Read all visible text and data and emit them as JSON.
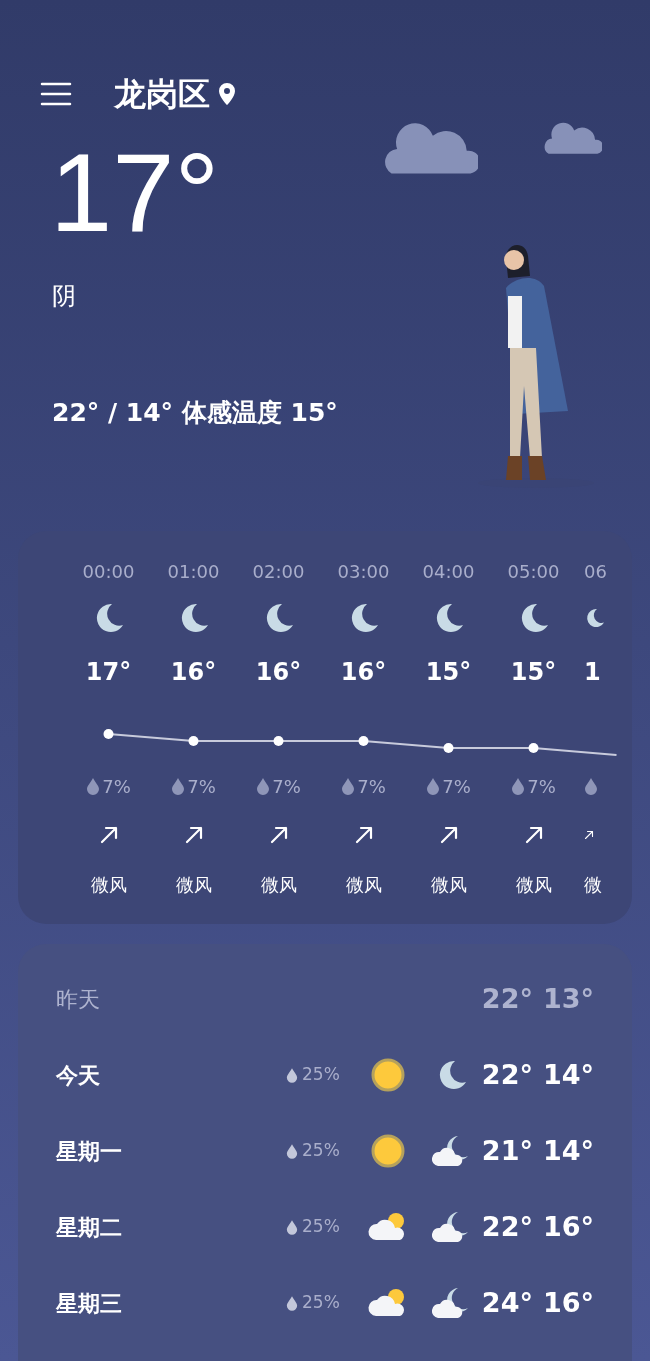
{
  "header": {
    "location": "龙岗区"
  },
  "current": {
    "temperature": "17°",
    "condition": "阴",
    "range": "22° / 14° 体感温度 15°"
  },
  "hourly": {
    "hours": [
      {
        "time": "00:00",
        "icon": {
          "kind": "moon"
        },
        "temp": "17°",
        "precip": "7%",
        "wind": "微风"
      },
      {
        "time": "01:00",
        "icon": {
          "kind": "moon"
        },
        "temp": "16°",
        "precip": "7%",
        "wind": "微风"
      },
      {
        "time": "02:00",
        "icon": {
          "kind": "moon"
        },
        "temp": "16°",
        "precip": "7%",
        "wind": "微风"
      },
      {
        "time": "03:00",
        "icon": {
          "kind": "moon"
        },
        "temp": "16°",
        "precip": "7%",
        "wind": "微风"
      },
      {
        "time": "04:00",
        "icon": {
          "kind": "moon"
        },
        "temp": "15°",
        "precip": "7%",
        "wind": "微风"
      },
      {
        "time": "05:00",
        "icon": {
          "kind": "moon"
        },
        "temp": "15°",
        "precip": "7%",
        "wind": "微风"
      },
      {
        "time": "06",
        "icon": {
          "kind": "moon"
        },
        "temp": "1",
        "wind": "微",
        "partial": true
      }
    ]
  },
  "daily": [
    {
      "kind": "past",
      "day": "昨天",
      "high": "22°",
      "low": "13°"
    },
    {
      "kind": "forecast",
      "day": "今天",
      "precip": "25%",
      "icons": [
        {
          "kind": "sun"
        },
        {
          "kind": "moon"
        }
      ],
      "high": "22°",
      "low": "14°"
    },
    {
      "kind": "forecast",
      "day": "星期一",
      "precip": "25%",
      "icons": [
        {
          "kind": "sun"
        },
        {
          "kind": "cloudy_moon"
        }
      ],
      "high": "21°",
      "low": "14°"
    },
    {
      "kind": "forecast",
      "day": "星期二",
      "precip": "25%",
      "icons": [
        {
          "kind": "partly_cloudy"
        },
        {
          "kind": "cloudy_moon"
        }
      ],
      "high": "22°",
      "low": "16°"
    },
    {
      "kind": "forecast",
      "day": "星期三",
      "precip": "25%",
      "icons": [
        {
          "kind": "partly_cloudy"
        },
        {
          "kind": "cloudy_moon"
        }
      ],
      "high": "24°",
      "low": "16°"
    }
  ]
}
